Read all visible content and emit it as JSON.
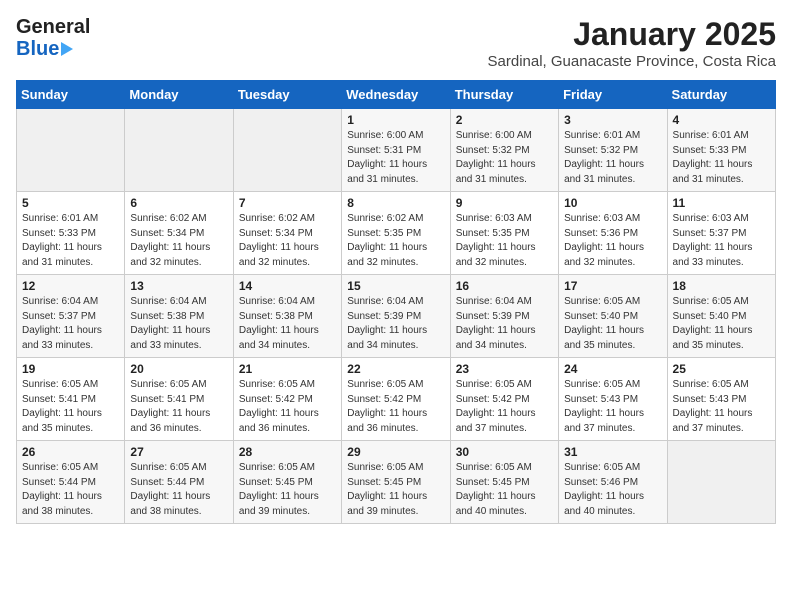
{
  "header": {
    "logo_general": "General",
    "logo_blue": "Blue",
    "month": "January 2025",
    "location": "Sardinal, Guanacaste Province, Costa Rica"
  },
  "weekdays": [
    "Sunday",
    "Monday",
    "Tuesday",
    "Wednesday",
    "Thursday",
    "Friday",
    "Saturday"
  ],
  "weeks": [
    [
      {
        "day": "",
        "info": ""
      },
      {
        "day": "",
        "info": ""
      },
      {
        "day": "",
        "info": ""
      },
      {
        "day": "1",
        "info": "Sunrise: 6:00 AM\nSunset: 5:31 PM\nDaylight: 11 hours and 31 minutes."
      },
      {
        "day": "2",
        "info": "Sunrise: 6:00 AM\nSunset: 5:32 PM\nDaylight: 11 hours and 31 minutes."
      },
      {
        "day": "3",
        "info": "Sunrise: 6:01 AM\nSunset: 5:32 PM\nDaylight: 11 hours and 31 minutes."
      },
      {
        "day": "4",
        "info": "Sunrise: 6:01 AM\nSunset: 5:33 PM\nDaylight: 11 hours and 31 minutes."
      }
    ],
    [
      {
        "day": "5",
        "info": "Sunrise: 6:01 AM\nSunset: 5:33 PM\nDaylight: 11 hours and 31 minutes."
      },
      {
        "day": "6",
        "info": "Sunrise: 6:02 AM\nSunset: 5:34 PM\nDaylight: 11 hours and 32 minutes."
      },
      {
        "day": "7",
        "info": "Sunrise: 6:02 AM\nSunset: 5:34 PM\nDaylight: 11 hours and 32 minutes."
      },
      {
        "day": "8",
        "info": "Sunrise: 6:02 AM\nSunset: 5:35 PM\nDaylight: 11 hours and 32 minutes."
      },
      {
        "day": "9",
        "info": "Sunrise: 6:03 AM\nSunset: 5:35 PM\nDaylight: 11 hours and 32 minutes."
      },
      {
        "day": "10",
        "info": "Sunrise: 6:03 AM\nSunset: 5:36 PM\nDaylight: 11 hours and 32 minutes."
      },
      {
        "day": "11",
        "info": "Sunrise: 6:03 AM\nSunset: 5:37 PM\nDaylight: 11 hours and 33 minutes."
      }
    ],
    [
      {
        "day": "12",
        "info": "Sunrise: 6:04 AM\nSunset: 5:37 PM\nDaylight: 11 hours and 33 minutes."
      },
      {
        "day": "13",
        "info": "Sunrise: 6:04 AM\nSunset: 5:38 PM\nDaylight: 11 hours and 33 minutes."
      },
      {
        "day": "14",
        "info": "Sunrise: 6:04 AM\nSunset: 5:38 PM\nDaylight: 11 hours and 34 minutes."
      },
      {
        "day": "15",
        "info": "Sunrise: 6:04 AM\nSunset: 5:39 PM\nDaylight: 11 hours and 34 minutes."
      },
      {
        "day": "16",
        "info": "Sunrise: 6:04 AM\nSunset: 5:39 PM\nDaylight: 11 hours and 34 minutes."
      },
      {
        "day": "17",
        "info": "Sunrise: 6:05 AM\nSunset: 5:40 PM\nDaylight: 11 hours and 35 minutes."
      },
      {
        "day": "18",
        "info": "Sunrise: 6:05 AM\nSunset: 5:40 PM\nDaylight: 11 hours and 35 minutes."
      }
    ],
    [
      {
        "day": "19",
        "info": "Sunrise: 6:05 AM\nSunset: 5:41 PM\nDaylight: 11 hours and 35 minutes."
      },
      {
        "day": "20",
        "info": "Sunrise: 6:05 AM\nSunset: 5:41 PM\nDaylight: 11 hours and 36 minutes."
      },
      {
        "day": "21",
        "info": "Sunrise: 6:05 AM\nSunset: 5:42 PM\nDaylight: 11 hours and 36 minutes."
      },
      {
        "day": "22",
        "info": "Sunrise: 6:05 AM\nSunset: 5:42 PM\nDaylight: 11 hours and 36 minutes."
      },
      {
        "day": "23",
        "info": "Sunrise: 6:05 AM\nSunset: 5:42 PM\nDaylight: 11 hours and 37 minutes."
      },
      {
        "day": "24",
        "info": "Sunrise: 6:05 AM\nSunset: 5:43 PM\nDaylight: 11 hours and 37 minutes."
      },
      {
        "day": "25",
        "info": "Sunrise: 6:05 AM\nSunset: 5:43 PM\nDaylight: 11 hours and 37 minutes."
      }
    ],
    [
      {
        "day": "26",
        "info": "Sunrise: 6:05 AM\nSunset: 5:44 PM\nDaylight: 11 hours and 38 minutes."
      },
      {
        "day": "27",
        "info": "Sunrise: 6:05 AM\nSunset: 5:44 PM\nDaylight: 11 hours and 38 minutes."
      },
      {
        "day": "28",
        "info": "Sunrise: 6:05 AM\nSunset: 5:45 PM\nDaylight: 11 hours and 39 minutes."
      },
      {
        "day": "29",
        "info": "Sunrise: 6:05 AM\nSunset: 5:45 PM\nDaylight: 11 hours and 39 minutes."
      },
      {
        "day": "30",
        "info": "Sunrise: 6:05 AM\nSunset: 5:45 PM\nDaylight: 11 hours and 40 minutes."
      },
      {
        "day": "31",
        "info": "Sunrise: 6:05 AM\nSunset: 5:46 PM\nDaylight: 11 hours and 40 minutes."
      },
      {
        "day": "",
        "info": ""
      }
    ]
  ]
}
